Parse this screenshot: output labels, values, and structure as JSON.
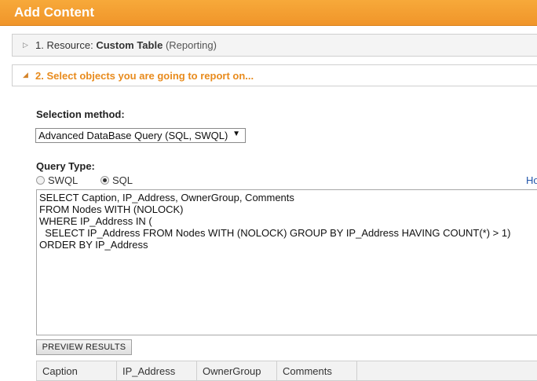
{
  "header": {
    "title": "Add Content"
  },
  "sections": {
    "resource": {
      "prefix": "1. Resource: ",
      "name": "Custom Table",
      "suffix": " (Reporting)",
      "arrow": "▷"
    },
    "select_objects": {
      "label": "2. Select objects you are going to report on...",
      "arrow": "◢"
    }
  },
  "selection": {
    "label": "Selection method:",
    "value": "Advanced DataBase Query (SQL, SWQL)",
    "caret": "▼"
  },
  "query_type": {
    "label": "Query Type:",
    "options": [
      {
        "label": "SWQL",
        "checked": false
      },
      {
        "label": "SQL",
        "checked": true
      }
    ],
    "help_link": "Ho"
  },
  "query": {
    "text": "SELECT Caption, IP_Address, OwnerGroup, Comments\nFROM Nodes WITH (NOLOCK)\nWHERE IP_Address IN (\n  SELECT IP_Address FROM Nodes WITH (NOLOCK) GROUP BY IP_Address HAVING COUNT(*) > 1)\nORDER BY IP_Address"
  },
  "preview_button": {
    "label": "PREVIEW RESULTS"
  },
  "results": {
    "columns": [
      "Caption",
      "IP_Address",
      "OwnerGroup",
      "Comments",
      ""
    ]
  },
  "colors": {
    "header_orange": "#f0952a",
    "section_active": "#e88b1d",
    "link": "#2255aa"
  }
}
